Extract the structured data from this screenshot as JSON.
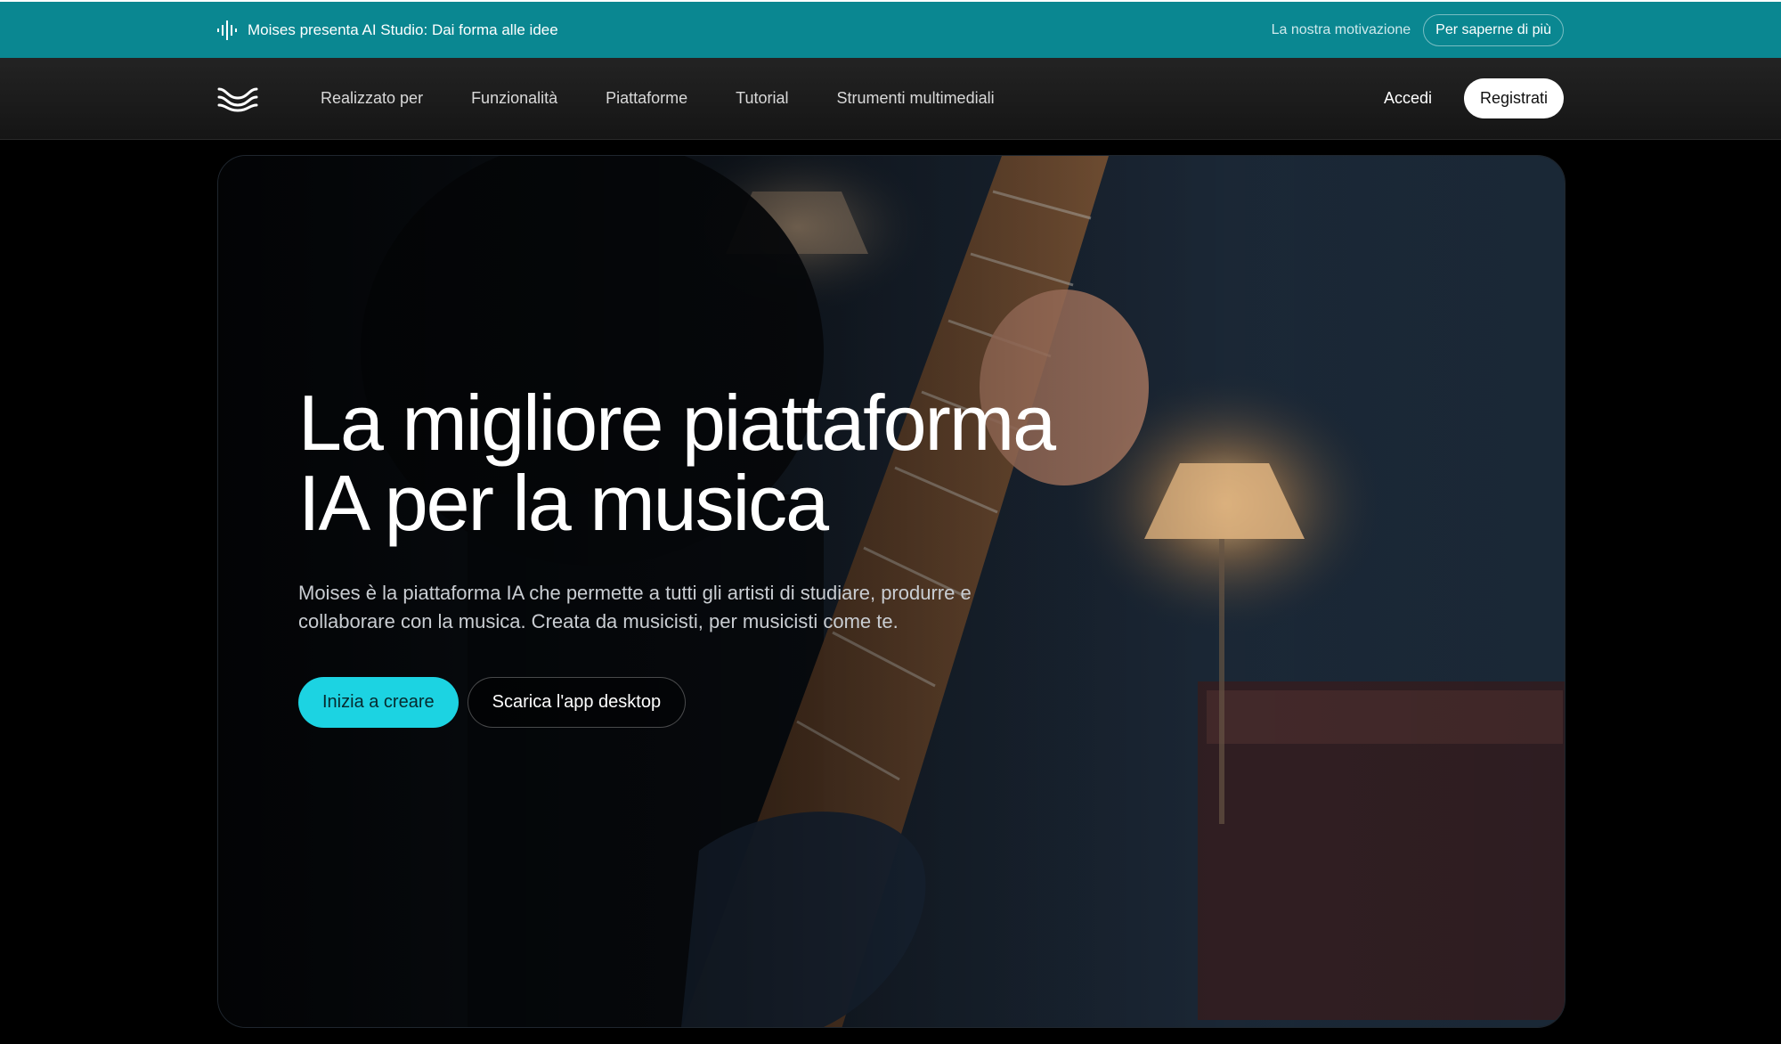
{
  "announcement": {
    "icon": "soundwave-icon",
    "text": "Moises presenta AI Studio: Dai forma alle idee",
    "link_label": "La nostra motivazione",
    "button_label": "Per saperne di più"
  },
  "nav": {
    "logo": "moises-logo",
    "items": [
      {
        "label": "Realizzato per"
      },
      {
        "label": "Funzionalità"
      },
      {
        "label": "Piattaforme"
      },
      {
        "label": "Tutorial"
      },
      {
        "label": "Strumenti multimediali"
      }
    ],
    "login_label": "Accedi",
    "signup_label": "Registrati"
  },
  "hero": {
    "title": "La migliore piattaforma IA per la musica",
    "subtitle": "Moises è la piattaforma IA che permette a tutti gli artisti di studiare, produrre e collaborare con la musica. Creata da musicisti, per musicisti come te.",
    "primary_cta": "Inizia a creare",
    "secondary_cta": "Scarica l'app desktop"
  },
  "colors": {
    "announcement_bg": "#0a8791",
    "primary_accent": "#1cd3e2",
    "page_bg": "#000000"
  }
}
